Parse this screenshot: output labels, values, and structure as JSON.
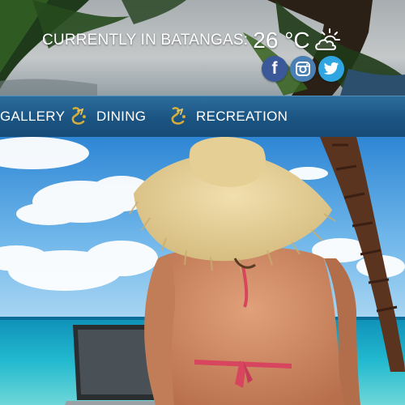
{
  "header": {
    "weather_label": "CURRENTLY IN BATANGAS:",
    "temperature": "26 °C",
    "weather_icon": "sun-behind-cloud-icon"
  },
  "social": [
    {
      "name": "facebook",
      "icon": "facebook-icon",
      "glyph": "f",
      "color": "#3b5998"
    },
    {
      "name": "instagram",
      "icon": "instagram-icon",
      "color": "#4a7fb3"
    },
    {
      "name": "twitter",
      "icon": "twitter-icon",
      "color": "#2fa6e2"
    }
  ],
  "nav": {
    "items": [
      {
        "label": "GALLERY"
      },
      {
        "label": "DINING",
        "icon": "resort-logo-icon"
      },
      {
        "label": "RECREATION",
        "icon": "resort-logo-icon"
      }
    ],
    "background": "#1b5482",
    "logo_color": "#c9a227"
  },
  "hero": {
    "description_colors": {
      "sky": "#4aa3e0",
      "sea": "#1fb0c8",
      "sand": "#d8c9a8"
    }
  }
}
